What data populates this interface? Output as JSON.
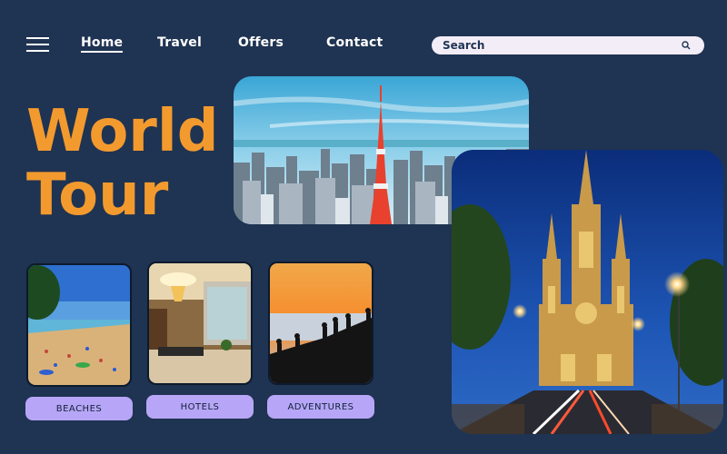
{
  "nav": {
    "items": [
      {
        "label": "Home"
      },
      {
        "label": "Travel"
      },
      {
        "label": "Offers"
      },
      {
        "label": "Contact"
      }
    ]
  },
  "search": {
    "placeholder": "Search"
  },
  "hero": {
    "title_line1": "World",
    "title_line2": "Tour"
  },
  "categories": [
    {
      "label": "BEACHES"
    },
    {
      "label": "HOTELS"
    },
    {
      "label": "ADVENTURES"
    }
  ],
  "colors": {
    "background": "#1f3352",
    "accent": "#f39a2e",
    "button": "#b7a6f7"
  }
}
